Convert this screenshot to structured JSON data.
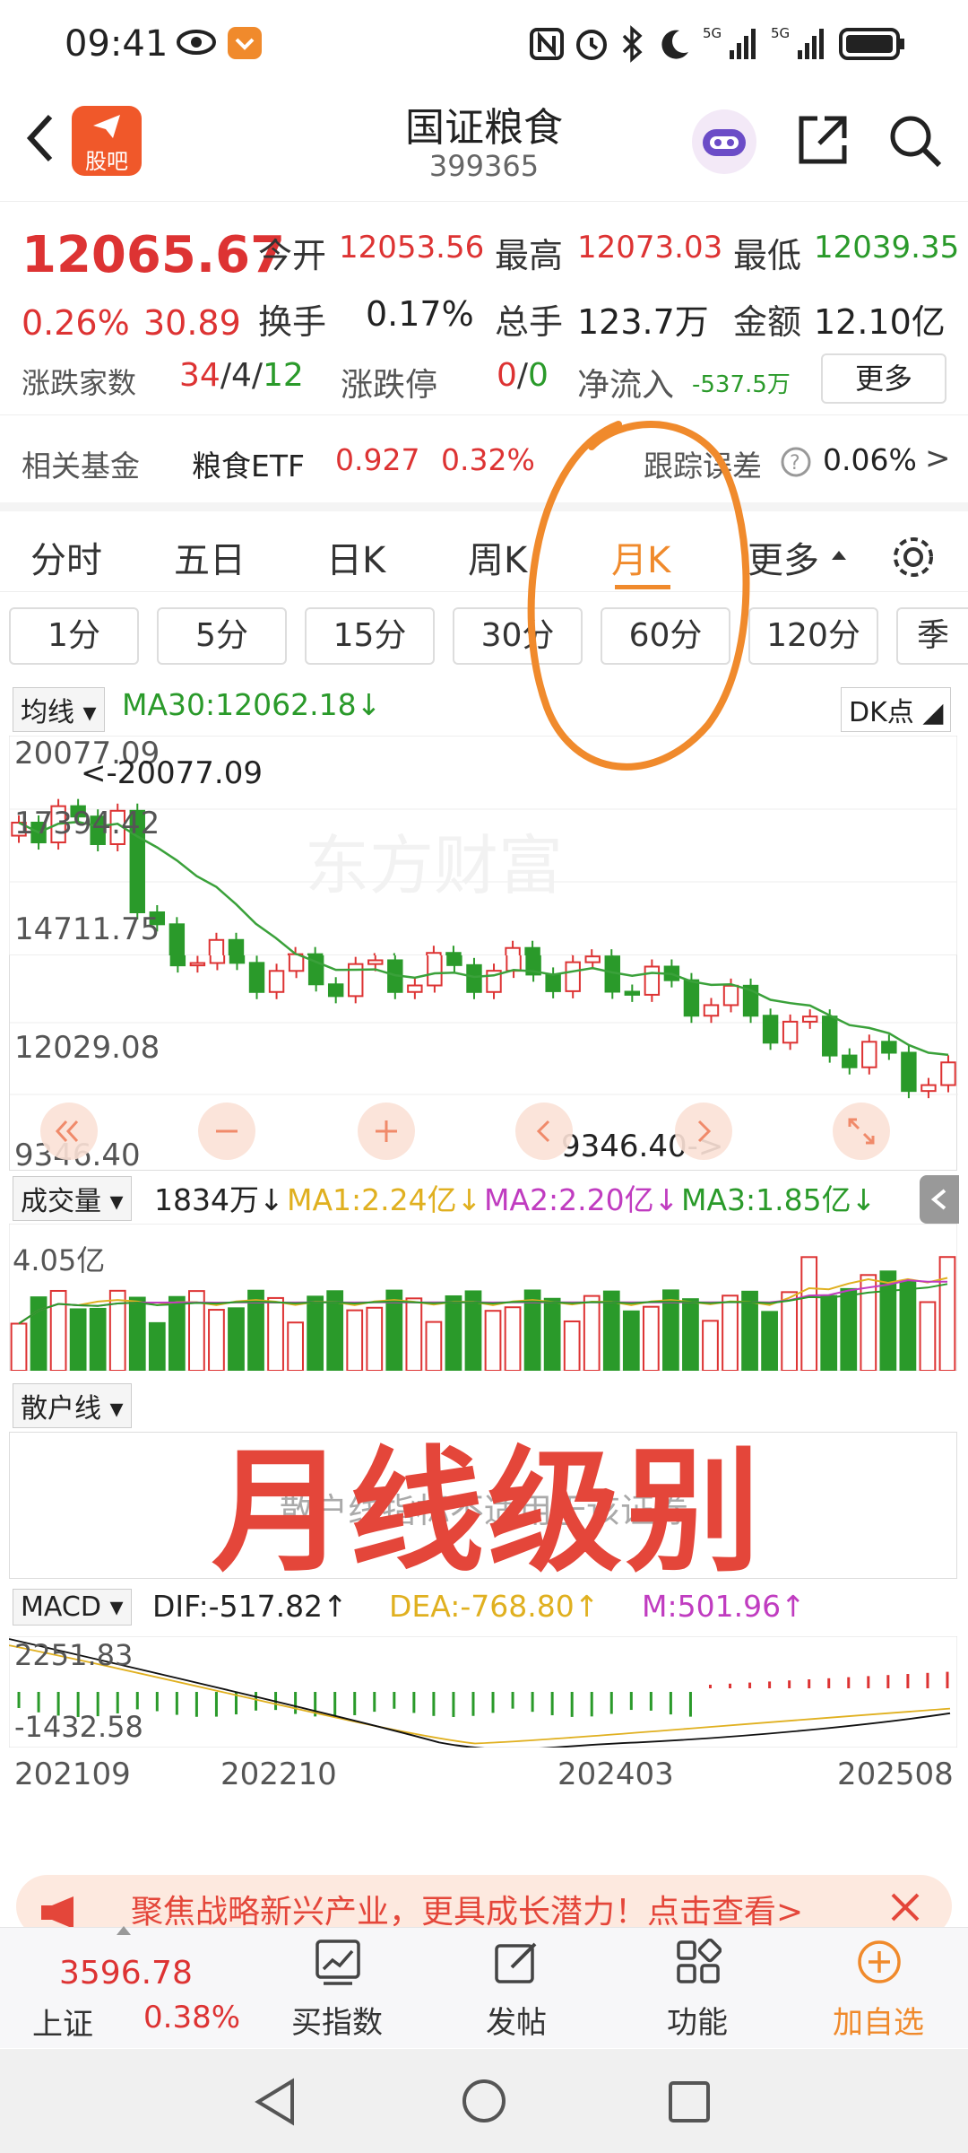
{
  "status_bar": {
    "time": "09:41"
  },
  "header": {
    "title": "国证粮食",
    "code": "399365",
    "app_badge": "股吧"
  },
  "quote": {
    "price": "12065.67",
    "change_pct": "0.26%",
    "change": "30.89",
    "open_label": "今开",
    "open": "12053.56",
    "high_label": "最高",
    "high": "12073.03",
    "low_label": "最低",
    "low": "12039.35",
    "turnover_label": "换手",
    "turnover": "0.17%",
    "volume_label": "总手",
    "volume": "123.7万",
    "amount_label": "金额",
    "amount": "12.10亿",
    "breadth_label": "涨跌家数",
    "up": "34",
    "flat": "4",
    "down": "12",
    "limit_label": "涨跌停",
    "limit_up": "0",
    "limit_down": "0",
    "netflow_label": "净流入",
    "netflow": "-537.5万",
    "more_label": "更多"
  },
  "fund": {
    "label": "相关基金",
    "name": "粮食ETF",
    "price": "0.927",
    "pct": "0.32%",
    "track_label": "跟踪误差",
    "track": "0.06%",
    "arrow": ">"
  },
  "tabs": [
    "分时",
    "五日",
    "日K",
    "周K",
    "月K",
    "更多"
  ],
  "active_tab": "月K",
  "periods": [
    "1分",
    "5分",
    "15分",
    "30分",
    "60分",
    "120分",
    "季"
  ],
  "kline": {
    "ma_selector": "均线",
    "ma30": "MA30:12062.18↓",
    "dk_label": "DK点",
    "y_labels": [
      "20077.09",
      "17394.42",
      "14711.75",
      "12029.08",
      "9346.40"
    ],
    "high_mark": "<-20077.09",
    "low_mark": "9346.40->",
    "watermark": "东方财富"
  },
  "volume": {
    "selector": "成交量",
    "value": "1834万↓",
    "ma1": "MA1:2.24亿↓",
    "ma2": "MA2:2.20亿↓",
    "ma3": "MA3:1.85亿↓",
    "y_top": "4.05亿"
  },
  "retail": {
    "selector": "散户线",
    "message": "散户线指标不适用于该证券"
  },
  "overlay_text": "月线级别",
  "macd": {
    "selector": "MACD",
    "dif": "DIF:-517.82↑",
    "dea": "DEA:-768.80↑",
    "m": "M:501.96↑",
    "y_top": "2251.83",
    "y_bottom": "-1432.58"
  },
  "x_labels": [
    "202109",
    "202210",
    "202403",
    "202508"
  ],
  "banner": {
    "text": "聚焦战略新兴产业，更具成长潜力！点击查看>"
  },
  "bottom_nav": {
    "index_name": "上证",
    "index_value": "3596.78",
    "index_pct": "0.38%",
    "items": [
      "买指数",
      "发帖",
      "功能",
      "加自选"
    ]
  },
  "colors": {
    "up": "#d33",
    "down": "#2a9a2a",
    "accent": "#f08a2c"
  }
}
